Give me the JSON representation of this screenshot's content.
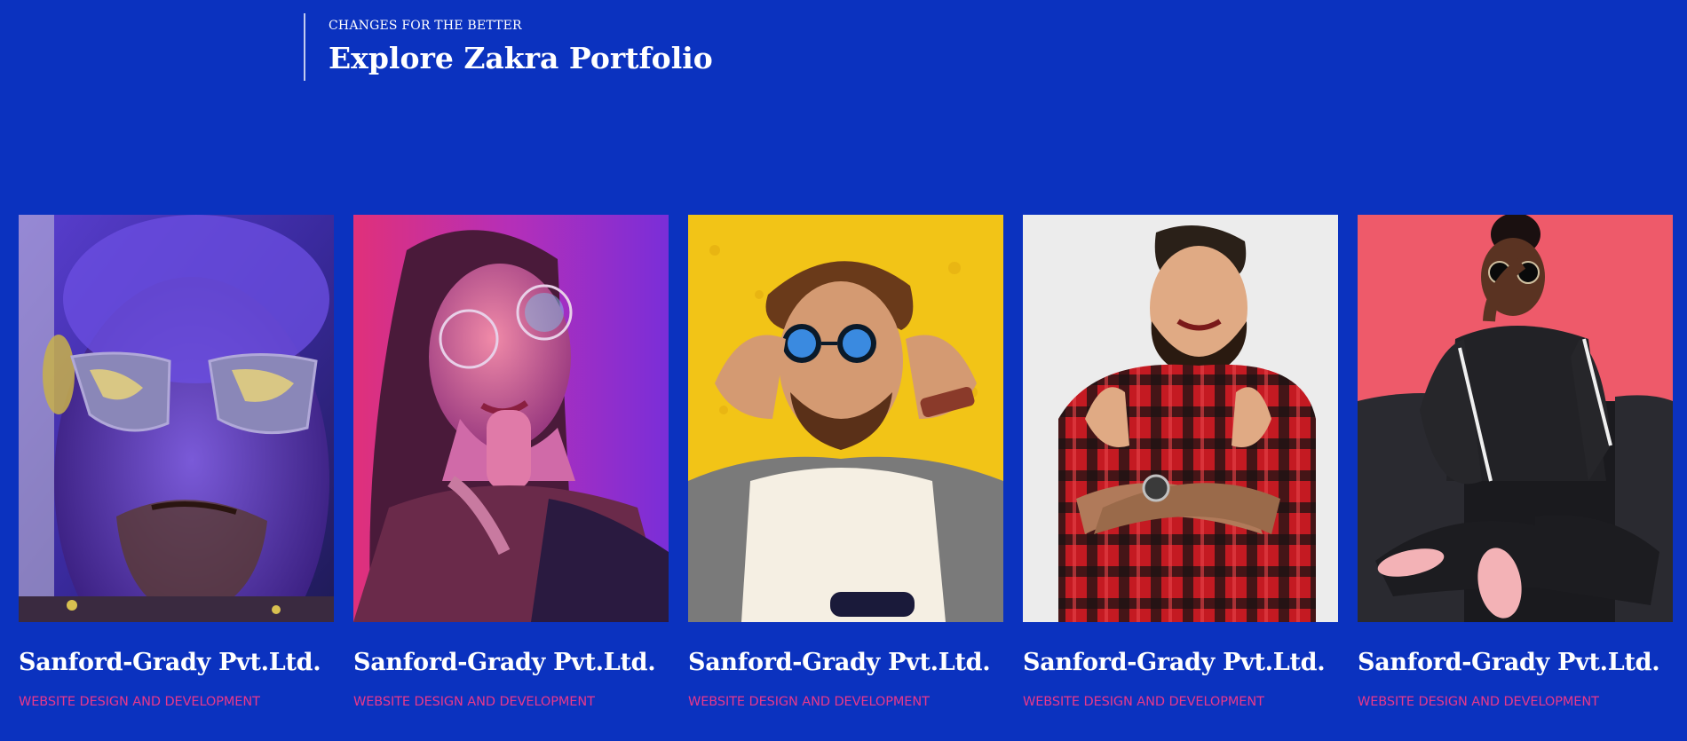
{
  "section": {
    "kicker": "CHANGES FOR THE BETTER",
    "title": "Explore Zakra Portfolio"
  },
  "colors": {
    "background": "#0b32bf",
    "text": "#ffffff",
    "category": "#e8388c"
  },
  "portfolio": {
    "items": [
      {
        "title": "Sanford-Grady Pvt.Ltd.",
        "category": "WEBSITE DESIGN AND DEVELOPMENT"
      },
      {
        "title": "Sanford-Grady Pvt.Ltd.",
        "category": "WEBSITE DESIGN AND DEVELOPMENT"
      },
      {
        "title": "Sanford-Grady Pvt.Ltd.",
        "category": "WEBSITE DESIGN AND DEVELOPMENT"
      },
      {
        "title": "Sanford-Grady Pvt.Ltd.",
        "category": "WEBSITE DESIGN AND DEVELOPMENT"
      },
      {
        "title": "Sanford-Grady Pvt.Ltd.",
        "category": "WEBSITE DESIGN AND DEVELOPMENT"
      }
    ]
  }
}
